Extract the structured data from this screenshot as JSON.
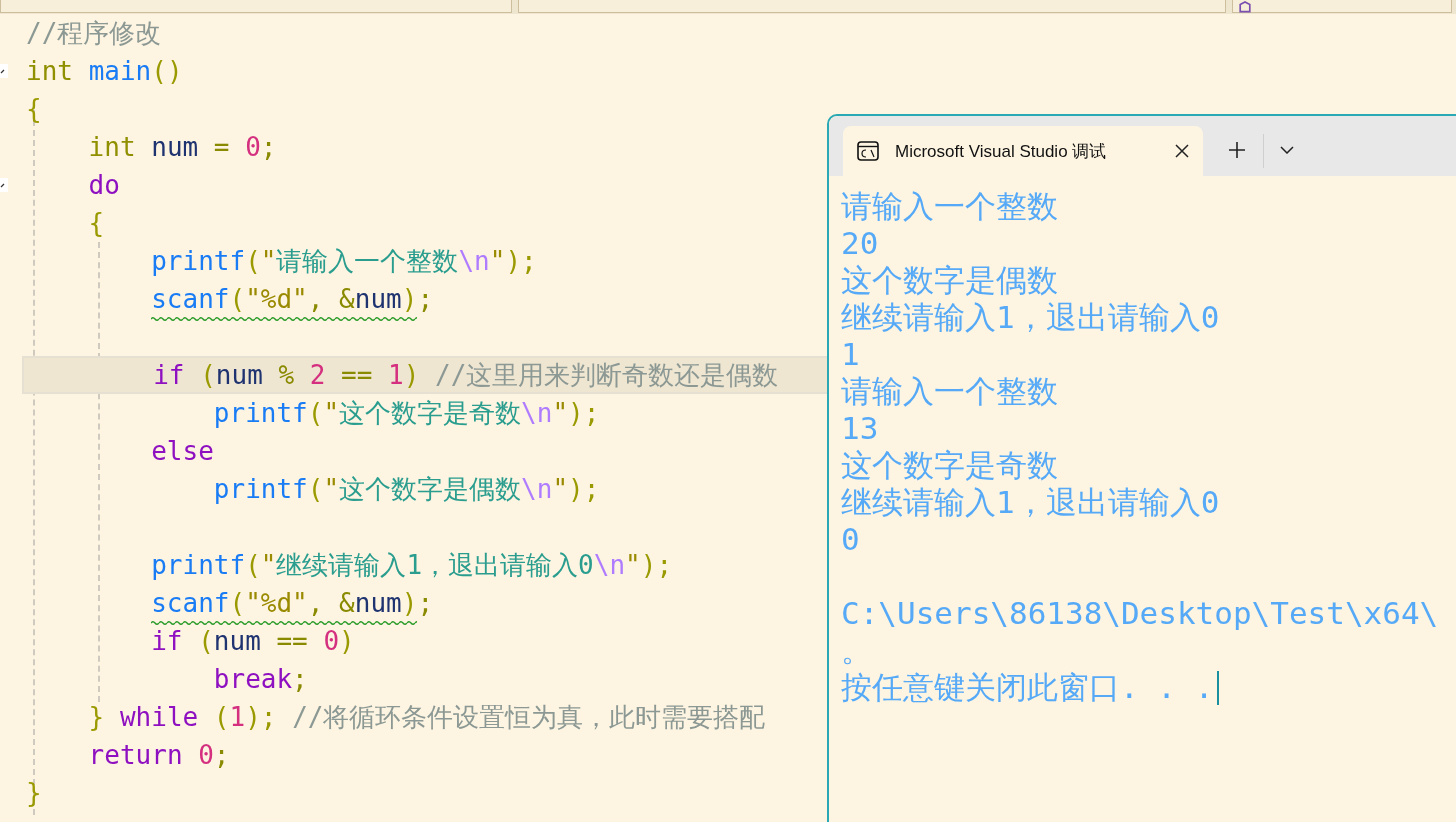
{
  "top_bar": {
    "dropdowns": [
      {
        "kind": "plain"
      },
      {
        "kind": "plain"
      },
      {
        "kind": "function"
      }
    ]
  },
  "editor": {
    "lines": [
      {
        "kind": "code",
        "current": false,
        "tokens": [
          {
            "text": "//程序修改",
            "kind": "comment"
          }
        ]
      },
      {
        "kind": "code",
        "current": false,
        "fold": true,
        "tokens": [
          {
            "text": "int ",
            "kind": "type"
          },
          {
            "text": "main",
            "kind": "function"
          },
          {
            "text": "()",
            "kind": "paren"
          }
        ]
      },
      {
        "kind": "code",
        "current": false,
        "tokens": [
          {
            "text": "{",
            "kind": "paren"
          }
        ],
        "children": [
          {
            "kind": "code",
            "current": false,
            "tokens": [
              {
                "text": "int ",
                "kind": "type"
              },
              {
                "text": "num ",
                "kind": "ident"
              },
              {
                "text": "= ",
                "kind": "op"
              },
              {
                "text": "0",
                "kind": "number"
              },
              {
                "text": ";",
                "kind": "op"
              }
            ]
          },
          {
            "kind": "code",
            "current": false,
            "fold": true,
            "tokens": [
              {
                "text": "do",
                "kind": "keyword"
              }
            ]
          },
          {
            "kind": "code",
            "current": false,
            "tokens": [
              {
                "text": "{",
                "kind": "paren"
              }
            ],
            "children": [
              {
                "kind": "code",
                "current": false,
                "tokens": [
                  {
                    "text": "printf",
                    "kind": "function"
                  },
                  {
                    "text": "(",
                    "kind": "paren"
                  },
                  {
                    "text": "\"",
                    "kind": "quote"
                  },
                  {
                    "text": "请输入一个整数",
                    "kind": "string"
                  },
                  {
                    "text": "\\n",
                    "kind": "escape"
                  },
                  {
                    "text": "\"",
                    "kind": "quote"
                  },
                  {
                    "text": ");",
                    "kind": "paren"
                  }
                ]
              },
              {
                "kind": "code",
                "current": false,
                "warned": [
                  {
                    "text": "scanf",
                    "kind": "function"
                  },
                  {
                    "text": "(",
                    "kind": "paren"
                  },
                  {
                    "text": "\"%d\"",
                    "kind": "quote"
                  },
                  {
                    "text": ", &",
                    "kind": "op"
                  },
                  {
                    "text": "num",
                    "kind": "ident"
                  },
                  {
                    "text": ")",
                    "kind": "paren"
                  }
                ],
                "tokens": [
                  {
                    "text": ";",
                    "kind": "op"
                  }
                ]
              },
              {
                "kind": "blank"
              },
              {
                "kind": "code",
                "current": true,
                "tokens": [
                  {
                    "text": "if ",
                    "kind": "keyword"
                  },
                  {
                    "text": "(",
                    "kind": "paren"
                  },
                  {
                    "text": "num ",
                    "kind": "ident"
                  },
                  {
                    "text": "% ",
                    "kind": "op"
                  },
                  {
                    "text": "2 ",
                    "kind": "number"
                  },
                  {
                    "text": "== ",
                    "kind": "op"
                  },
                  {
                    "text": "1",
                    "kind": "number"
                  },
                  {
                    "text": ") ",
                    "kind": "paren"
                  },
                  {
                    "text": "//这里用来判断奇数还是偶数",
                    "kind": "comment"
                  }
                ],
                "children": [
                  {
                    "kind": "code",
                    "current": false,
                    "tokens": [
                      {
                        "text": "printf",
                        "kind": "function"
                      },
                      {
                        "text": "(",
                        "kind": "paren"
                      },
                      {
                        "text": "\"",
                        "kind": "quote"
                      },
                      {
                        "text": "这个数字是奇数",
                        "kind": "string"
                      },
                      {
                        "text": "\\n",
                        "kind": "escape"
                      },
                      {
                        "text": "\"",
                        "kind": "quote"
                      },
                      {
                        "text": ");",
                        "kind": "paren"
                      }
                    ]
                  }
                ]
              },
              {
                "kind": "code",
                "current": false,
                "tokens": [
                  {
                    "text": "else",
                    "kind": "keyword"
                  }
                ],
                "children": [
                  {
                    "kind": "code",
                    "current": false,
                    "tokens": [
                      {
                        "text": "printf",
                        "kind": "function"
                      },
                      {
                        "text": "(",
                        "kind": "paren"
                      },
                      {
                        "text": "\"",
                        "kind": "quote"
                      },
                      {
                        "text": "这个数字是偶数",
                        "kind": "string"
                      },
                      {
                        "text": "\\n",
                        "kind": "escape"
                      },
                      {
                        "text": "\"",
                        "kind": "quote"
                      },
                      {
                        "text": ");",
                        "kind": "paren"
                      }
                    ]
                  }
                ]
              },
              {
                "kind": "blank"
              },
              {
                "kind": "code",
                "current": false,
                "tokens": [
                  {
                    "text": "printf",
                    "kind": "function"
                  },
                  {
                    "text": "(",
                    "kind": "paren"
                  },
                  {
                    "text": "\"",
                    "kind": "quote"
                  },
                  {
                    "text": "继续请输入1，退出请输入0",
                    "kind": "string"
                  },
                  {
                    "text": "\\n",
                    "kind": "escape"
                  },
                  {
                    "text": "\"",
                    "kind": "quote"
                  },
                  {
                    "text": ");",
                    "kind": "paren"
                  }
                ]
              },
              {
                "kind": "code",
                "current": false,
                "warned": [
                  {
                    "text": "scanf",
                    "kind": "function"
                  },
                  {
                    "text": "(",
                    "kind": "paren"
                  },
                  {
                    "text": "\"%d\"",
                    "kind": "quote"
                  },
                  {
                    "text": ", &",
                    "kind": "op"
                  },
                  {
                    "text": "num",
                    "kind": "ident"
                  },
                  {
                    "text": ")",
                    "kind": "paren"
                  }
                ],
                "tokens": [
                  {
                    "text": ";",
                    "kind": "op"
                  }
                ]
              },
              {
                "kind": "code",
                "current": false,
                "tokens": [
                  {
                    "text": "if ",
                    "kind": "keyword"
                  },
                  {
                    "text": "(",
                    "kind": "paren"
                  },
                  {
                    "text": "num ",
                    "kind": "ident"
                  },
                  {
                    "text": "== ",
                    "kind": "op"
                  },
                  {
                    "text": "0",
                    "kind": "number"
                  },
                  {
                    "text": ")",
                    "kind": "paren"
                  }
                ],
                "children": [
                  {
                    "kind": "code",
                    "current": false,
                    "tokens": [
                      {
                        "text": "break",
                        "kind": "keyword"
                      },
                      {
                        "text": ";",
                        "kind": "op"
                      }
                    ]
                  }
                ]
              }
            ]
          },
          {
            "kind": "code",
            "current": false,
            "tokens": [
              {
                "text": "} ",
                "kind": "paren"
              },
              {
                "text": "while ",
                "kind": "keyword"
              },
              {
                "text": "(",
                "kind": "paren"
              },
              {
                "text": "1",
                "kind": "number"
              },
              {
                "text": "); ",
                "kind": "paren"
              },
              {
                "text": "//将循环条件设置恒为真，此时需要搭配",
                "kind": "comment"
              }
            ]
          },
          {
            "kind": "code",
            "current": false,
            "tokens": [
              {
                "text": "return ",
                "kind": "keyword"
              },
              {
                "text": "0",
                "kind": "number"
              },
              {
                "text": ";",
                "kind": "op"
              }
            ]
          }
        ]
      },
      {
        "kind": "code",
        "current": false,
        "tokens": [
          {
            "text": "}",
            "kind": "paren"
          }
        ]
      }
    ]
  },
  "console": {
    "tab": {
      "title": "Microsoft Visual Studio 调试",
      "selected": true
    },
    "lines": [
      {
        "kind": "text",
        "text": "请输入一个整数",
        "cursor": false
      },
      {
        "kind": "text",
        "text": "20",
        "cursor": false
      },
      {
        "kind": "text",
        "text": "这个数字是偶数",
        "cursor": false
      },
      {
        "kind": "text",
        "text": "继续请输入1，退出请输入0",
        "cursor": false
      },
      {
        "kind": "text",
        "text": "1",
        "cursor": false
      },
      {
        "kind": "text",
        "text": "请输入一个整数",
        "cursor": false
      },
      {
        "kind": "text",
        "text": "13",
        "cursor": false
      },
      {
        "kind": "text",
        "text": "这个数字是奇数",
        "cursor": false
      },
      {
        "kind": "text",
        "text": "继续请输入1，退出请输入0",
        "cursor": false
      },
      {
        "kind": "text",
        "text": "0",
        "cursor": false
      },
      {
        "kind": "blank"
      },
      {
        "kind": "text",
        "text": "C:\\Users\\86138\\Desktop\\Test\\x64\\",
        "cursor": false
      },
      {
        "kind": "text",
        "text": "。",
        "cursor": false
      },
      {
        "kind": "text",
        "text": "按任意键关闭此窗口. . .",
        "cursor": true
      }
    ]
  }
}
